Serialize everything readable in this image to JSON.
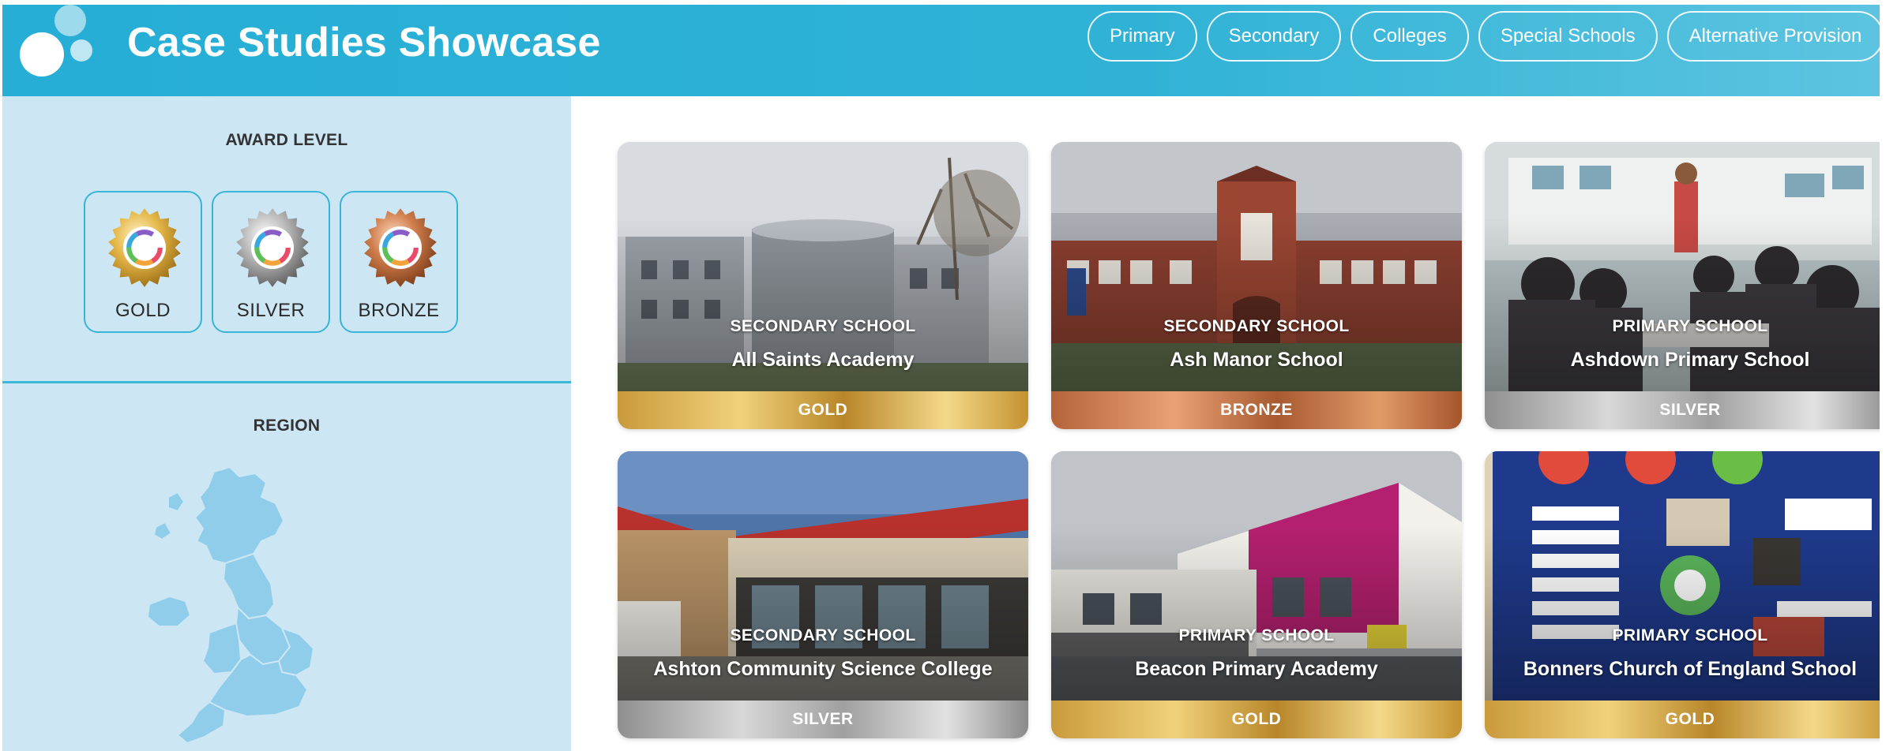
{
  "header": {
    "title": "Case Studies Showcase",
    "nav": [
      "Primary",
      "Secondary",
      "Colleges",
      "Special Schools",
      "Alternative Provision"
    ]
  },
  "sidebar": {
    "award_heading": "AWARD LEVEL",
    "awards": [
      {
        "label": "GOLD",
        "color": "#d9a93c"
      },
      {
        "label": "SILVER",
        "color": "#9a9a9a"
      },
      {
        "label": "BRONZE",
        "color": "#c06a3c"
      }
    ],
    "region_heading": "REGION"
  },
  "cards": [
    {
      "type": "SECONDARY SCHOOL",
      "name": "All Saints Academy",
      "award": "GOLD"
    },
    {
      "type": "SECONDARY SCHOOL",
      "name": "Ash Manor School",
      "award": "BRONZE"
    },
    {
      "type": "PRIMARY SCHOOL",
      "name": "Ashdown Primary School",
      "award": "SILVER"
    },
    {
      "type": "SECONDARY SCHOOL",
      "name": "Ashton Community Science College",
      "award": "SILVER"
    },
    {
      "type": "PRIMARY SCHOOL",
      "name": "Beacon Primary Academy",
      "award": "GOLD"
    },
    {
      "type": "PRIMARY SCHOOL",
      "name": "Bonners Church of England School",
      "award": "GOLD"
    }
  ],
  "colors": {
    "header": "#2fb2d6",
    "sidebar": "#cde6f4",
    "accent": "#38b4d6",
    "map": "#8fcdeb"
  }
}
